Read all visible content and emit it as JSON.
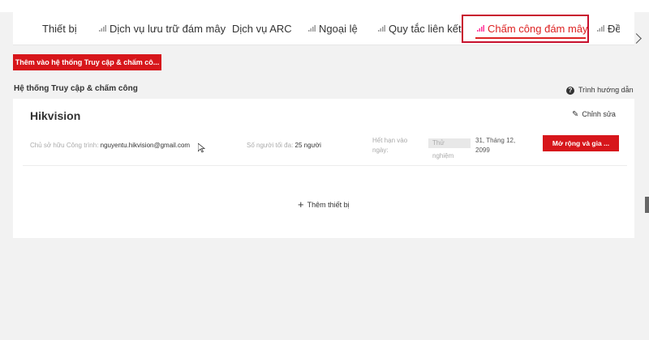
{
  "tabs": [
    {
      "label": "Thiết bị",
      "icon": "",
      "active": false
    },
    {
      "label": "Dịch vụ lưu trữ đám mây",
      "icon": "signal-bars-icon",
      "active": false
    },
    {
      "label": "Dịch vụ ARC",
      "icon": "",
      "active": false
    },
    {
      "label": "Ngoại lệ",
      "icon": "signal-bars-icon",
      "active": false
    },
    {
      "label": "Quy tắc liên kết",
      "icon": "signal-bars-icon",
      "active": false
    },
    {
      "label": "Chấm công đám mây",
      "icon": "signal-bars-icon",
      "active": true
    },
    {
      "label": "Đề",
      "icon": "signal-bars-icon",
      "active": false
    }
  ],
  "toolbar": {
    "add_label": "Thêm vào hệ thống Truy cập & chấm cô..."
  },
  "section": {
    "title": "Hệ thống Truy cập & chấm công",
    "guide_label": "Trình hướng dẫn"
  },
  "card": {
    "title": "Hikvision",
    "edit_label": "Chỉnh sửa",
    "owner_label": "Chủ sở hữu Công trình:",
    "owner_value": "nguyentu.hikvision@gmail.com",
    "people_label": "Số người tối đa:",
    "people_value": "25 người",
    "expire_label": "Hết hạn vào ngày:",
    "trial_tag_1": "Thử",
    "trial_tag_2": "nghiệm",
    "expire_date": "31, Tháng 12, 2099",
    "expand_label": "Mở rộng và gia ...",
    "add_device_label": "Thêm thiết bị"
  },
  "colors": {
    "accent": "#d7161b",
    "tab_highlight_box": "#c8102e",
    "background": "#f2f2f2"
  }
}
